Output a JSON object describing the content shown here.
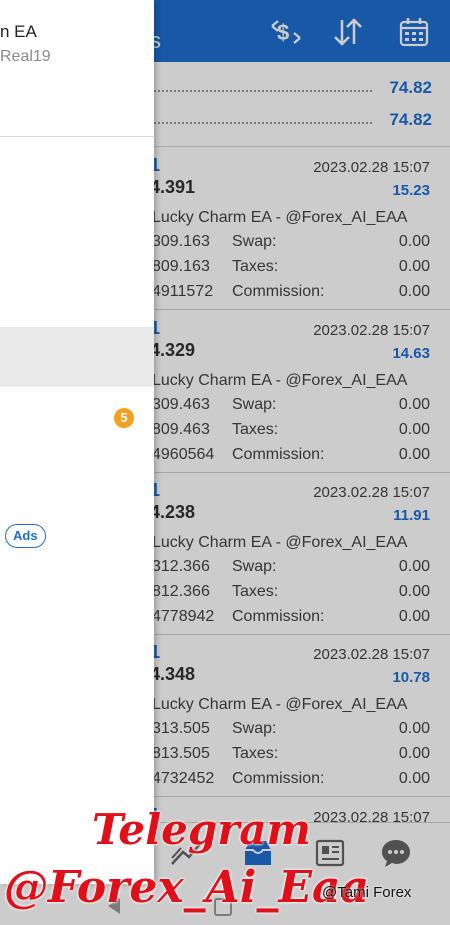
{
  "header": {
    "title_fragment": "s",
    "icons": [
      "exchange-dollar-icon",
      "sort-arrows-icon",
      "calendar-icon"
    ]
  },
  "summary": {
    "values": [
      "74.82",
      "74.82"
    ]
  },
  "trades": [
    {
      "symbol_fragment": "1",
      "price_fragment": "4.391",
      "datetime": "2023.02.28 15:07",
      "profit": "15.23",
      "comment": "Lucky Charm EA - @Forex_AI_EAA",
      "rows": [
        {
          "num": "309.163",
          "label": "Swap:",
          "value": "0.00"
        },
        {
          "num": "809.163",
          "label": "Taxes:",
          "value": "0.00"
        },
        {
          "num": "4911572",
          "label": "Commission:",
          "value": "0.00"
        }
      ]
    },
    {
      "symbol_fragment": "1",
      "price_fragment": "4.329",
      "datetime": "2023.02.28 15:07",
      "profit": "14.63",
      "comment": "Lucky Charm EA - @Forex_AI_EAA",
      "rows": [
        {
          "num": "309.463",
          "label": "Swap:",
          "value": "0.00"
        },
        {
          "num": "809.463",
          "label": "Taxes:",
          "value": "0.00"
        },
        {
          "num": "4960564",
          "label": "Commission:",
          "value": "0.00"
        }
      ]
    },
    {
      "symbol_fragment": "1",
      "price_fragment": "4.238",
      "datetime": "2023.02.28 15:07",
      "profit": "11.91",
      "comment": "Lucky Charm EA - @Forex_AI_EAA",
      "rows": [
        {
          "num": "312.366",
          "label": "Swap:",
          "value": "0.00"
        },
        {
          "num": "812.366",
          "label": "Taxes:",
          "value": "0.00"
        },
        {
          "num": "4778942",
          "label": "Commission:",
          "value": "0.00"
        }
      ]
    },
    {
      "symbol_fragment": "1",
      "price_fragment": "4.348",
      "datetime": "2023.02.28 15:07",
      "profit": "10.78",
      "comment": "Lucky Charm EA - @Forex_AI_EAA",
      "rows": [
        {
          "num": "313.505",
          "label": "Swap:",
          "value": "0.00"
        },
        {
          "num": "813.505",
          "label": "Taxes:",
          "value": "0.00"
        },
        {
          "num": "4732452",
          "label": "Commission:",
          "value": "0.00"
        }
      ]
    },
    {
      "symbol_fragment": "1",
      "datetime": "2023.02.28 15:07"
    }
  ],
  "bottom_nav": {
    "icons": [
      "chart-trend-icon",
      "inbox-icon",
      "news-icon",
      "chat-icon"
    ],
    "active": "inbox-icon"
  },
  "drawer": {
    "account_name_fragment": "n EA",
    "account_server_fragment": "Real19",
    "badge_count": "5",
    "ads_label": "Ads"
  },
  "watermark": {
    "line1": "Telegram",
    "line2": "@Forex_Ai_Eaa",
    "credit": "@Tami Forex"
  },
  "colors": {
    "accent": "#1f6fd0",
    "badge": "#f4a021",
    "watermark": "#e0101a"
  }
}
